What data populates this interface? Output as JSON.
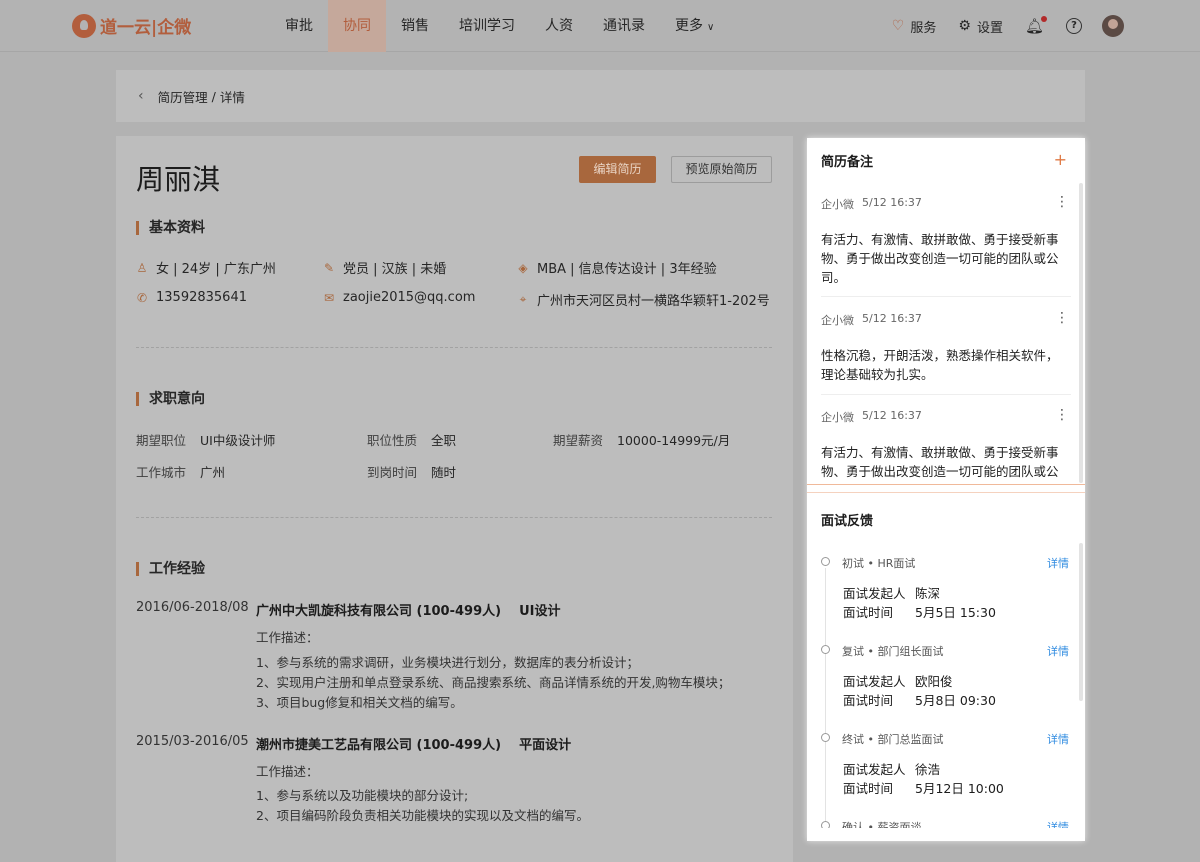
{
  "brand": {
    "name": "道一云|企微",
    "color": "#b25e3d"
  },
  "nav": {
    "items": [
      "审批",
      "协同",
      "销售",
      "培训学习",
      "人资",
      "通讯录",
      "更多"
    ],
    "active_index": 1
  },
  "tools": {
    "service": "服务",
    "settings": "设置"
  },
  "breadcrumb": {
    "parent": "简历管理",
    "sep": "/",
    "current": "详情"
  },
  "resume": {
    "name": "周丽淇",
    "edit_button": "编辑简历",
    "preview_button": "预览原始简历",
    "basic_title": "基本资料",
    "basic": {
      "gender_age_place": "女 | 24岁 | 广东广州",
      "party_ethnic_marital": "党员 | 汉族 | 未婚",
      "edu_major_exp": "MBA | 信息传达设计 | 3年经验",
      "phone": "13592835641",
      "email": "zaojie2015@qq.com",
      "address": "广州市天河区员村一横路华颖轩1-202号"
    },
    "intent_title": "求职意向",
    "intent": {
      "position_label": "期望职位",
      "position": "UI中级设计师",
      "type_label": "职位性质",
      "type": "全职",
      "salary_label": "期望薪资",
      "salary": "10000-14999元/月",
      "city_label": "工作城市",
      "city": "广州",
      "arrival_label": "到岗时间",
      "arrival": "随时"
    },
    "exp_title": "工作经验",
    "experience": [
      {
        "period": "2016/06-2018/08",
        "company": "广州中大凯旋科技有限公司 (100-499人)",
        "role": "UI设计",
        "desc_label": "工作描述：",
        "lines": [
          "1、参与系统的需求调研，业务模块进行划分，数据库的表分析设计；",
          "2、实现用户注册和单点登录系统、商品搜索系统、商品详情系统的开发,购物车模块；",
          "3、项目bug修复和相关文档的编写。"
        ]
      },
      {
        "period": "2015/03-2016/05",
        "company": "潮州市捷美工艺品有限公司 (100-499人)",
        "role": "平面设计",
        "desc_label": "工作描述：",
        "lines": [
          "1、参与系统以及功能模块的部分设计;",
          "2、项目编码阶段负责相关功能模块的实现以及文档的编写。"
        ]
      }
    ]
  },
  "notes": {
    "title": "简历备注",
    "add_icon": "+",
    "items": [
      {
        "author": "企小微",
        "time": "5/12 16:37",
        "text": "有活力、有激情、敢拼敢做、勇于接受新事物、勇于做出改变创造一切可能的团队或公司。"
      },
      {
        "author": "企小微",
        "time": "5/12 16:37",
        "text": "性格沉稳，开朗活泼，熟悉操作相关软件，理论基础较为扎实。"
      },
      {
        "author": "企小微",
        "time": "5/12 16:37",
        "text": "有活力、有激情、敢拼敢做、勇于接受新事物、勇于做出改变创造一切可能的团队或公司。"
      }
    ]
  },
  "feedback": {
    "title": "面试反馈",
    "initiator_label": "面试发起人",
    "time_label": "面试时间",
    "detail_label": "详情",
    "items": [
      {
        "stage": "初试 • HR面试",
        "initiator": "陈深",
        "time": "5月5日 15:30"
      },
      {
        "stage": "复试 • 部门组长面试",
        "initiator": "欧阳俊",
        "time": "5月8日 09:30"
      },
      {
        "stage": "终试 • 部门总监面试",
        "initiator": "徐浩",
        "time": "5月12日 10:00"
      },
      {
        "stage": "确认 • 薪资面谈",
        "initiator": "",
        "time": ""
      }
    ]
  }
}
